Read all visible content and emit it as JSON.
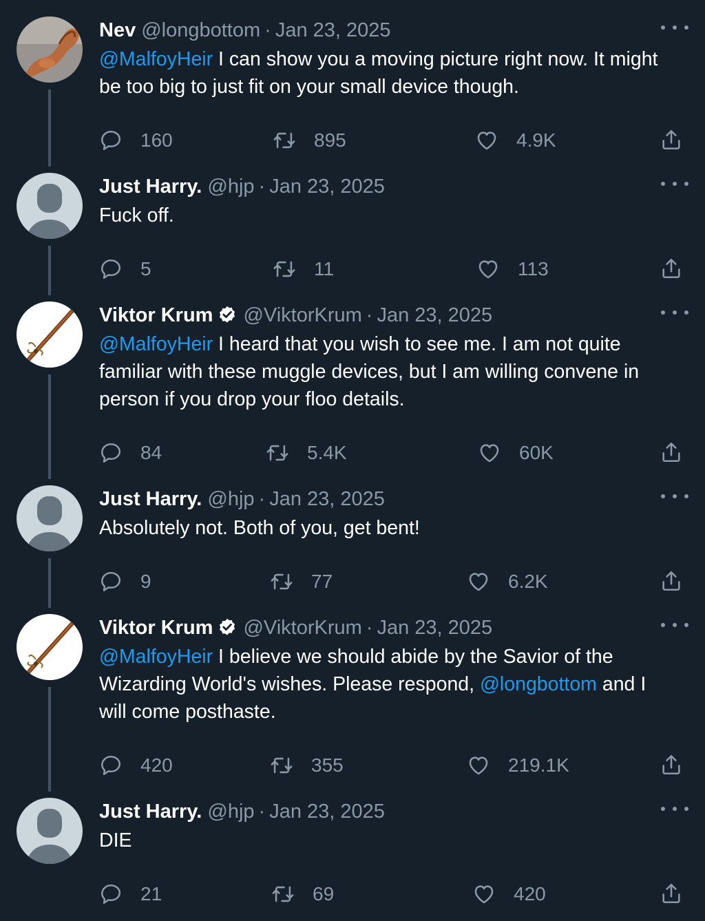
{
  "colors": {
    "background": "#15202b",
    "text_primary": "#ffffff",
    "text_secondary": "#8b98a5",
    "mention": "#1d9bf0",
    "thread_line": "#425364"
  },
  "tweets": [
    {
      "name": "Nev",
      "handle": "@longbottom",
      "sep": "·",
      "date": "Jan 23, 2025",
      "avatar": "muscle-arm-avatar",
      "verified": false,
      "body": [
        {
          "mention": "@MalfoyHeir",
          "text": " I can show you a moving picture right now. It might"
        },
        {
          "text": "be too big to just fit on your small device though."
        }
      ],
      "replies": "160",
      "retweets": "895",
      "likes": "4.9K"
    },
    {
      "name": "Just Harry.",
      "handle": "@hjp",
      "sep": "·",
      "date": "Jan 23, 2025",
      "avatar": "default-avatar",
      "verified": false,
      "body": [
        {
          "text": "Fuck off."
        }
      ],
      "replies": "5",
      "retweets": "11",
      "likes": "113"
    },
    {
      "name": "Viktor Krum",
      "handle": "@ViktorKrum",
      "sep": "·",
      "date": "Jan 23, 2025",
      "avatar": "broomstick-avatar",
      "verified": true,
      "body": [
        {
          "mention": "@MalfoyHeir",
          "text": " I heard that you wish to see me. I am not quite"
        },
        {
          "text": "familiar with these muggle devices, but I am willing convene in"
        },
        {
          "text": "person if you drop your floo details."
        }
      ],
      "replies": "84",
      "retweets": "5.4K",
      "likes": "60K"
    },
    {
      "name": "Just Harry.",
      "handle": "@hjp",
      "sep": "·",
      "date": "Jan 23, 2025",
      "avatar": "default-avatar",
      "verified": false,
      "body": [
        {
          "text": "Absolutely not. Both of you, get bent!"
        }
      ],
      "replies": "9",
      "retweets": "77",
      "likes": "6.2K"
    },
    {
      "name": "Viktor Krum",
      "handle": "@ViktorKrum",
      "sep": "·",
      "date": "Jan 23, 2025",
      "avatar": "broomstick-avatar",
      "verified": true,
      "body": [
        {
          "mention": "@MalfoyHeir",
          "text": " I believe we should abide by the Savior of the"
        },
        {
          "text": "Wizarding World's wishes. Please respond, ",
          "mention_after": "@longbottom",
          "text_after": " and I"
        },
        {
          "text": "will come posthaste."
        }
      ],
      "replies": "420",
      "retweets": "355",
      "likes": "219.1K"
    },
    {
      "name": "Just Harry.",
      "handle": "@hjp",
      "sep": "·",
      "date": "Jan 23, 2025",
      "avatar": "default-avatar",
      "verified": false,
      "body": [
        {
          "text": "DIE"
        }
      ],
      "replies": "21",
      "retweets": "69",
      "likes": "420"
    }
  ]
}
